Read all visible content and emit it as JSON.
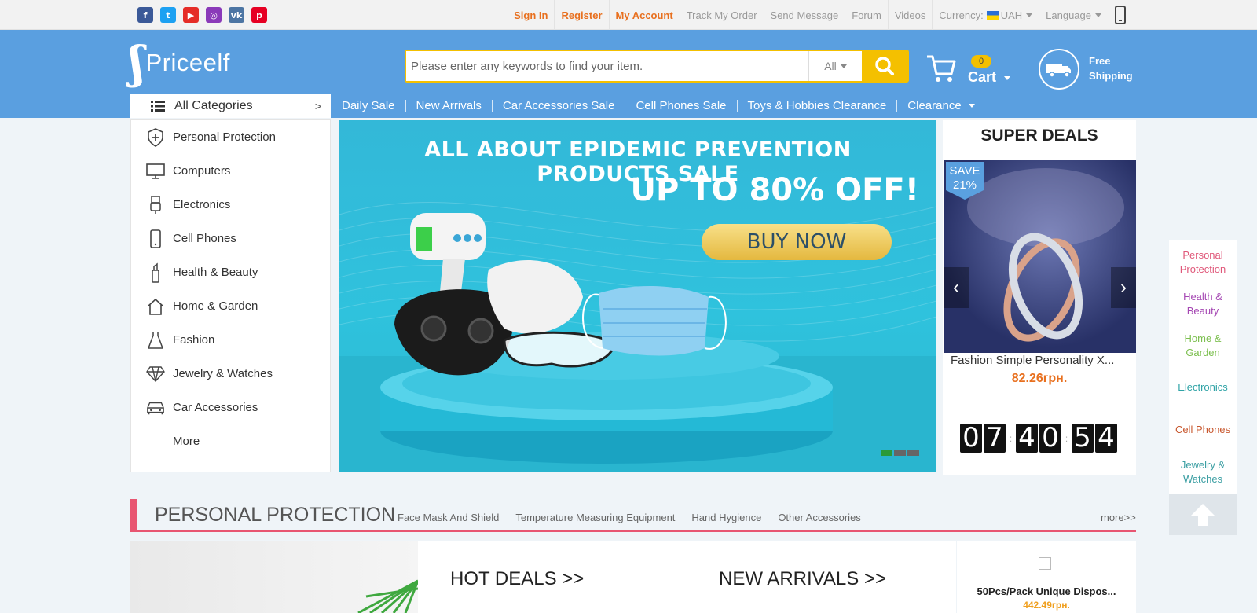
{
  "topbar": {
    "social": [
      {
        "icon": "facebook-icon",
        "glyph": "f",
        "color": "#3b5998"
      },
      {
        "icon": "twitter-icon",
        "glyph": "t",
        "color": "#1da1f2"
      },
      {
        "icon": "youtube-icon",
        "glyph": "▶",
        "color": "#e52d27"
      },
      {
        "icon": "instagram-icon",
        "glyph": "◎",
        "color": "#8a3ab9"
      },
      {
        "icon": "vk-icon",
        "glyph": "vk",
        "color": "#4c75a3"
      },
      {
        "icon": "pinterest-icon",
        "glyph": "p",
        "color": "#e60023"
      }
    ],
    "sign_in": "Sign In",
    "register": "Register",
    "my_account": "My Account",
    "track_order": "Track My Order",
    "send_message": "Send Message",
    "forum": "Forum",
    "videos": "Videos",
    "currency_label": "Currency:",
    "currency_value": "UAH",
    "language": "Language"
  },
  "header": {
    "logo_text": "Priceelf",
    "search_placeholder": "Please enter any keywords to find your item.",
    "search_scope": "All",
    "cart_count": "0",
    "cart_label": "Cart",
    "shipping_line1": "Free",
    "shipping_line2": "Shipping"
  },
  "nav": {
    "all_categories": "All Categories",
    "links": [
      "Daily Sale",
      "New Arrivals",
      "Car Accessories Sale",
      "Cell Phones Sale",
      "Toys & Hobbies Clearance",
      "Clearance"
    ]
  },
  "sidebar": {
    "items": [
      {
        "label": "Personal Protection",
        "icon": "shield-plus-icon"
      },
      {
        "label": "Computers",
        "icon": "monitor-icon"
      },
      {
        "label": "Electronics",
        "icon": "usb-icon"
      },
      {
        "label": "Cell Phones",
        "icon": "phone-icon"
      },
      {
        "label": "Health & Beauty",
        "icon": "bottle-icon"
      },
      {
        "label": "Home & Garden",
        "icon": "house-icon"
      },
      {
        "label": "Fashion",
        "icon": "dress-icon"
      },
      {
        "label": "Jewelry & Watches",
        "icon": "diamond-icon"
      },
      {
        "label": "Car Accessories",
        "icon": "car-icon"
      },
      {
        "label": "More",
        "icon": ""
      }
    ]
  },
  "banner": {
    "headline": "ALL ABOUT EPIDEMIC PREVENTION PRODUCTS SALE",
    "offer": "UP TO 80% OFF!",
    "cta": "BUY NOW",
    "slide_count": 3,
    "active_slide": 1
  },
  "super_deals": {
    "title": "SUPER DEALS",
    "badge_line1": "SAVE",
    "badge_line2": "21%",
    "product_name": "Fashion Simple Personality X...",
    "price": "82.26грн.",
    "timer": {
      "hours": "07",
      "minutes": "40",
      "seconds": "54"
    }
  },
  "float_nav": [
    {
      "label": "Personal Protection",
      "color": "#e0587a"
    },
    {
      "label": "Health & Beauty",
      "color": "#a547b3"
    },
    {
      "label": "Home & Garden",
      "color": "#7cbf4f"
    },
    {
      "label": "Electronics",
      "color": "#2fa3a6"
    },
    {
      "label": "Cell Phones",
      "color": "#c8582f"
    },
    {
      "label": "Jewelry & Watches",
      "color": "#3c9fa3"
    }
  ],
  "section": {
    "title": "PERSONAL PROTECTION",
    "links": [
      "Face Mask And Shield",
      "Temperature Measuring Equipment",
      "Hand Hygience",
      "Other Accessories"
    ],
    "more": "more>>",
    "hot_deals": "HOT DEALS >>",
    "new_arrivals": "NEW ARRIVALS >>",
    "product_name": "50Pcs/Pack Unique Dispos...",
    "product_price": "442.49грн."
  },
  "colors": {
    "brand_blue": "#5a9fe0",
    "accent_yellow": "#f4c000",
    "accent_orange": "#e8701f",
    "section_pink": "#e85672"
  }
}
